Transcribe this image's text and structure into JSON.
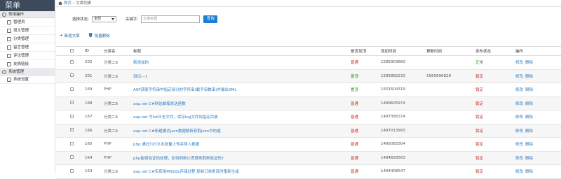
{
  "sidebar": {
    "title": "菜单",
    "sections": [
      {
        "label": "常用操作",
        "items": [
          "管理员",
          "增文管理",
          "分类管理",
          "留言管理",
          "评论管理",
          "友情链接"
        ]
      },
      {
        "label": "系统管理",
        "items": [
          "系统设置"
        ]
      }
    ]
  },
  "breadcrumb": {
    "home": "首页",
    "sep": "›",
    "current": "文章列表"
  },
  "search": {
    "status_label": "选择状态:",
    "status_value": "全部",
    "keyword_label": "关键字:",
    "keyword_placeholder": "文章标题",
    "button": "查询"
  },
  "toolbar": {
    "add": "新增文章",
    "batch_delete": "批量删除"
  },
  "table": {
    "headers": [
      "ID",
      "分类名",
      "标题",
      "是否至顶",
      "添加时间",
      "更新时间",
      "发布状态",
      "操作"
    ],
    "rows": [
      {
        "id": "202",
        "category": "分类二6",
        "title": "新添加的",
        "top": "普通",
        "added": "1585903683",
        "updated": "",
        "status": "正常",
        "ops": [
          "修改",
          "删除"
        ]
      },
      {
        "id": "201",
        "category": "分类二6",
        "title": "测试---1",
        "top": "置顶",
        "added": "1585882233",
        "updated": "1585896828",
        "status": "锁定",
        "ops": [
          "修改",
          "删除"
        ]
      },
      {
        "id": "169",
        "category": "PHP",
        "title": "ASP获取字符串中指定部分的字符串(截字母数串)并输出XML",
        "top": "置顶",
        "added": "1501504319",
        "updated": "",
        "status": "锁定",
        "ops": [
          "修改",
          "删除"
        ]
      },
      {
        "id": "168",
        "category": "分类二6",
        "title": "asp.net C#网站邮箱发送函数",
        "top": "普通",
        "added": "1499605974",
        "updated": "",
        "status": "锁定",
        "ops": [
          "修改",
          "删除"
        ]
      },
      {
        "id": "167",
        "category": "分类二6",
        "title": "asp.net 写txt日志文件，保存log文件到指定目录",
        "top": "普通",
        "added": "1497356374",
        "updated": "",
        "status": "锁定",
        "ops": [
          "修改",
          "删除"
        ]
      },
      {
        "id": "166",
        "category": "分类二6",
        "title": "asp.net C#新建模式json数据解析获取json中的值",
        "top": "普通",
        "added": "1497013993",
        "updated": "",
        "status": "锁定",
        "ops": [
          "修改",
          "删除"
        ]
      },
      {
        "id": "165",
        "category": "PHP",
        "title": "php 通过TXT文本批量上传并导入数据",
        "top": "普通",
        "added": "1495083304",
        "updated": "",
        "status": "锁定",
        "ops": [
          "修改",
          "删除"
        ]
      },
      {
        "id": "164",
        "category": "PHP",
        "title": "php能够验证码处理，如何刷新止恶意刷取刷验证码?",
        "top": "普通",
        "added": "1494828563",
        "updated": "",
        "status": "锁定",
        "ops": [
          "修改",
          "删除"
        ]
      },
      {
        "id": "163",
        "category": "分类二6",
        "title": "asp.net C#实现用MSSQL存储过程 复制订单条目时重新生成",
        "top": "普通",
        "added": "1494408547",
        "updated": "",
        "status": "锁定",
        "ops": [
          "修改",
          "删除"
        ]
      }
    ]
  },
  "colors": {
    "accent": "#1e7fd2",
    "sidebar_header": "#3d4a5c",
    "danger": "#c9302c",
    "success": "#3c8d2f"
  }
}
